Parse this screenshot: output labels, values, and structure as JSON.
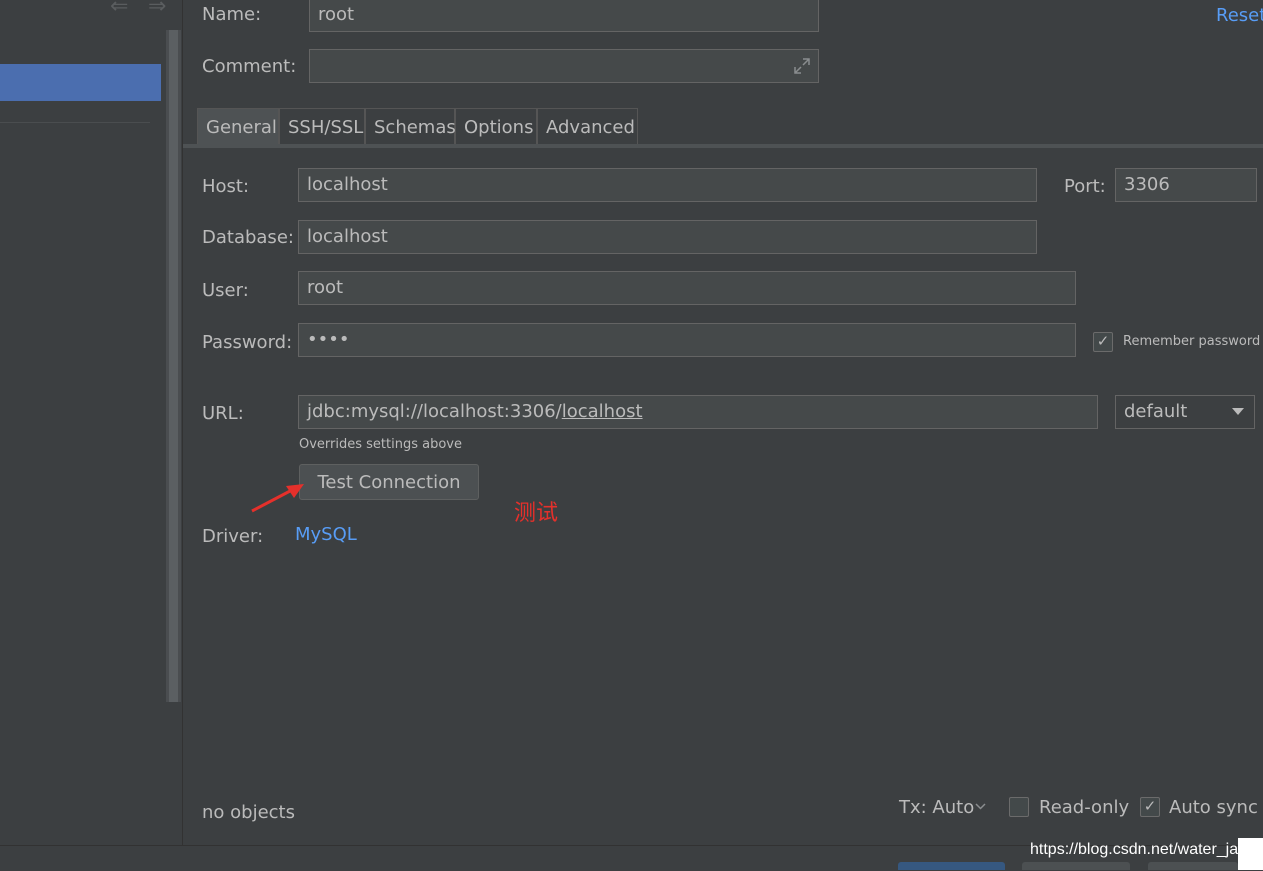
{
  "form": {
    "name_label": "Name:",
    "name_value": "root",
    "comment_label": "Comment:",
    "comment_value": "",
    "reset_link": "Reset"
  },
  "tabs": [
    {
      "label": "General",
      "active": true
    },
    {
      "label": "SSH/SSL",
      "active": false
    },
    {
      "label": "Schemas",
      "active": false
    },
    {
      "label": "Options",
      "active": false
    },
    {
      "label": "Advanced",
      "active": false
    }
  ],
  "general": {
    "host_label": "Host:",
    "host_value": "localhost",
    "port_label": "Port:",
    "port_value": "3306",
    "database_label": "Database:",
    "database_value": "localhost",
    "user_label": "User:",
    "user_value": "root",
    "password_label": "Password:",
    "password_value": "••••",
    "remember_password_label": "Remember password",
    "remember_password_checked": true,
    "url_label": "URL:",
    "url_prefix": "jdbc:mysql://localhost:3306/",
    "url_db": "localhost",
    "url_mode": "default",
    "url_hint": "Overrides settings above",
    "test_connection_button": "Test Connection",
    "annotation_text": "测试",
    "driver_label": "Driver:",
    "driver_value": "MySQL"
  },
  "status": {
    "objects_text": "no objects",
    "tx_label": "Tx: Auto",
    "readonly_label": "Read-only",
    "readonly_checked": false,
    "autosync_label": "Auto sync",
    "autosync_checked": true
  },
  "watermark": "https://blog.csdn.net/water_ja",
  "colors": {
    "background": "#3c3f41",
    "selection": "#4b6eaf",
    "link": "#589df6",
    "annotation": "#e5302b",
    "text": "#bbbbbb"
  },
  "icons": {
    "back": "back-arrow-icon",
    "forward": "forward-arrow-icon",
    "expand": "expand-icon",
    "dropdown": "chevron-down-icon",
    "annotation": "red-arrow-icon"
  }
}
